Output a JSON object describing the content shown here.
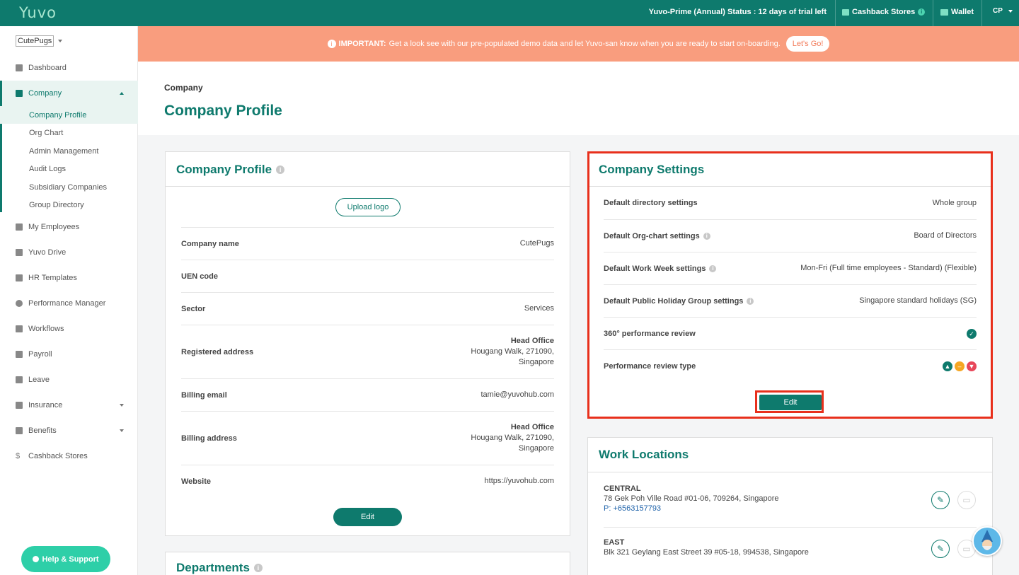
{
  "topbar": {
    "logo": "Yuvo",
    "status": "Yuvo-Prime (Annual) Status : 12 days of trial left",
    "cashback": "Cashback Stores",
    "wallet": "Wallet",
    "user": "CP",
    "accent": "#0e7a6d"
  },
  "sidebar": {
    "company_select": "CutePugs",
    "items": {
      "dashboard": "Dashboard",
      "company": "Company",
      "my_employees": "My Employees",
      "yuvo_drive": "Yuvo Drive",
      "hr_templates": "HR Templates",
      "performance_manager": "Performance Manager",
      "workflows": "Workflows",
      "payroll": "Payroll",
      "leave": "Leave",
      "insurance": "Insurance",
      "benefits": "Benefits",
      "cashback_stores": "Cashback Stores"
    },
    "company_sub": {
      "company_profile": "Company Profile",
      "org_chart": "Org Chart",
      "admin_management": "Admin Management",
      "audit_logs": "Audit Logs",
      "subsidiary_companies": "Subsidiary Companies",
      "group_directory": "Group Directory"
    },
    "help_button": "Help & Support"
  },
  "banner": {
    "important_label": "IMPORTANT:",
    "message": "Get a look see with our pre-populated demo data and let Yuvo-san know when you are ready to start on-boarding.",
    "button": "Let's Go!",
    "color": "#f99d7e"
  },
  "page": {
    "breadcrumb": "Company",
    "title": "Company Profile"
  },
  "profile_card": {
    "title": "Company Profile",
    "upload_logo": "Upload logo",
    "rows": {
      "company_name": {
        "label": "Company name",
        "value": "CutePugs"
      },
      "uen": {
        "label": "UEN code",
        "value": ""
      },
      "sector": {
        "label": "Sector",
        "value": "Services"
      },
      "registered_address": {
        "label": "Registered address",
        "heading": "Head Office",
        "line1": "Hougang Walk, 271090,",
        "line2": "Singapore"
      },
      "billing_email": {
        "label": "Billing email",
        "value": "tamie@yuvohub.com"
      },
      "billing_address": {
        "label": "Billing address",
        "heading": "Head Office",
        "line1": "Hougang Walk, 271090,",
        "line2": "Singapore"
      },
      "website": {
        "label": "Website",
        "value": "https://yuvohub.com"
      }
    },
    "edit_button": "Edit"
  },
  "departments_card": {
    "title": "Departments"
  },
  "settings_card": {
    "title": "Company Settings",
    "rows": {
      "directory": {
        "label": "Default directory settings",
        "value": "Whole group"
      },
      "org_chart": {
        "label": "Default Org-chart settings",
        "value": "Board of Directors"
      },
      "work_week": {
        "label": "Default Work Week settings",
        "value": "Mon-Fri (Full time employees - Standard) (Flexible)"
      },
      "public_holiday": {
        "label": "Default Public Holiday Group settings",
        "value": "Singapore standard holidays (SG)"
      },
      "review_360": {
        "label": "360° performance review"
      },
      "review_type": {
        "label": "Performance review type"
      }
    },
    "edit_button": "Edit",
    "highlight_color": "#e8301c"
  },
  "locations_card": {
    "title": "Work Locations",
    "items": [
      {
        "name": "CENTRAL",
        "address": "78 Gek Poh Ville Road #01-06, 709264, Singapore",
        "phone": "P: +6563157793"
      },
      {
        "name": "EAST",
        "address": "Blk 321 Geylang East Street 39 #05-18, 994538, Singapore",
        "phone": ""
      }
    ]
  }
}
